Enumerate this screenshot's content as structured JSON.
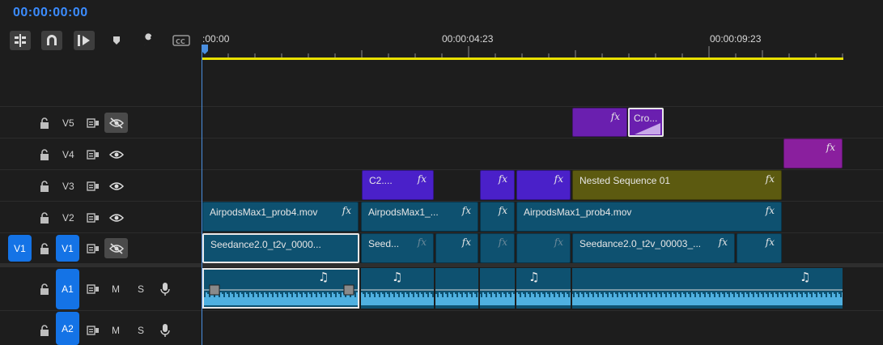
{
  "timecode": "00:00:00:00",
  "toolbar": [
    {
      "icon": "snap-to-sequence-icon",
      "active": true
    },
    {
      "icon": "magnet-icon",
      "active": true
    },
    {
      "icon": "linked-selection-icon",
      "active": true
    },
    {
      "icon": "add-marker-icon",
      "active": false
    },
    {
      "icon": "wrench-icon",
      "active": false
    },
    {
      "icon": "captions-icon",
      "active": false
    }
  ],
  "ruler": {
    "labels": [
      ":00:00",
      "00:00:04:23",
      "00:00:09:23"
    ]
  },
  "tracks": {
    "V5": {
      "label": "V5"
    },
    "V4": {
      "label": "V4"
    },
    "V3": {
      "label": "V3"
    },
    "V2": {
      "label": "V2"
    },
    "V1": {
      "label": "V1",
      "source": "V1"
    },
    "A1": {
      "label": "A1",
      "m": "M",
      "s": "S"
    },
    "A2": {
      "label": "A2",
      "m": "M",
      "s": "S"
    }
  },
  "clips": {
    "v5_fx": "fx",
    "v5_cro": "Cro...",
    "v4_fx": "fx",
    "v3_c2": "C2....",
    "v3_nested": "Nested Sequence 01",
    "v2_a": "AirpodsMax1_prob4.mov",
    "v2_b": "AirpodsMax1_...",
    "v2_c": "AirpodsMax1_prob4.mov",
    "v1_a": "Seedance2.0_t2v_0000...",
    "v1_b": "Seed...",
    "v1_c": "Seedance2.0_t2v_00003_...",
    "fx": "fx"
  },
  "colors": {
    "accent": "#1473e6",
    "timecode": "#3b8cff",
    "work_area": "#e8e000"
  }
}
